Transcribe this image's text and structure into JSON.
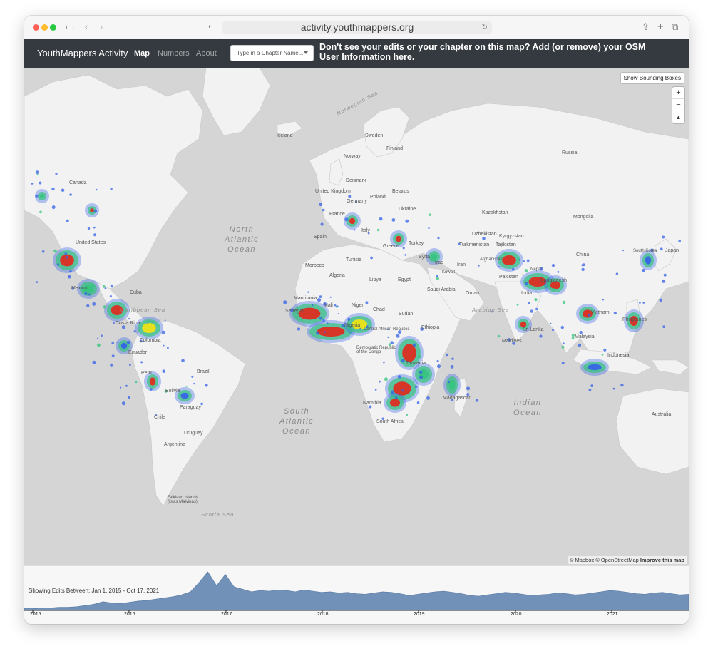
{
  "browser": {
    "url": "activity.youthmappers.org"
  },
  "navbar": {
    "brand": "YouthMappers Activity",
    "links": [
      "Map",
      "Numbers",
      "About"
    ],
    "chapter_placeholder": "Type in a Chapter Name...",
    "banner": "Don't see your edits or your chapter on this map? Add (or remove) your OSM User Information here."
  },
  "map": {
    "bounding_boxes_button": "Show Bounding Boxes",
    "zoom_in": "+",
    "zoom_out": "−",
    "compass": "▲",
    "attribution": "© Mapbox © OpenStreetMap",
    "improve": "Improve this map",
    "oceans": {
      "north_atlantic": "North Atlantic Ocean",
      "south_atlantic": "South Atlantic Ocean",
      "indian": "Indian Ocean",
      "norwegian_sea": "Norwegian Sea",
      "arabian_sea": "Arabian Sea",
      "caribbean_sea": "Caribbean Sea",
      "scotia_sea": "Scotia Sea"
    },
    "places": {
      "canada": "Canada",
      "united_states": "United States",
      "mexico": "Mexico",
      "cuba": "Cuba",
      "costa_rica": "Costa Rica",
      "colombia": "Colombia",
      "ecuador": "Ecuador",
      "peru": "Peru",
      "brazil": "Brazil",
      "bolivia": "Bolivia",
      "paraguay": "Paraguay",
      "chile": "Chile",
      "argentina": "Argentina",
      "uruguay": "Uruguay",
      "falkland": "Falkland Islands (Islas Malvinas)",
      "iceland": "Iceland",
      "sweden": "Sweden",
      "finland": "Finland",
      "norway": "Norway",
      "denmark": "Denmark",
      "united_kingdom": "United Kingdom",
      "poland": "Poland",
      "belarus": "Belarus",
      "germany": "Germany",
      "ukraine": "Ukraine",
      "france": "France",
      "italy": "Italy",
      "spain": "Spain",
      "greece": "Greece",
      "turkey": "Turkey",
      "russia": "Russia",
      "kazakhstan": "Kazakhstan",
      "mongolia": "Mongolia",
      "uzbekistan": "Uzbekistan",
      "kyrgyzstan": "Kyrgyzstan",
      "turkmenistan": "Turkmenistan",
      "tajikistan": "Tajikistan",
      "china": "China",
      "south_korea": "South Korea",
      "japan": "Japan",
      "syria": "Syria",
      "iraq": "Iraq",
      "iran": "Iran",
      "afghanistan": "Afghanistan",
      "pakistan": "Pakistan",
      "india": "India",
      "nepal": "Nepal",
      "bangladesh": "Bangladesh",
      "sri_lanka": "Sri Lanka",
      "maldives": "Maldives",
      "vietnam": "Vietnam",
      "philippines": "Philippines",
      "malaysia": "Malaysia",
      "indonesia": "Indonesia",
      "australia": "Australia",
      "morocco": "Morocco",
      "algeria": "Algeria",
      "tunisia": "Tunisia",
      "libya": "Libya",
      "egypt": "Egypt",
      "saudi_arabia": "Saudi Arabia",
      "oman": "Oman",
      "mauritania": "Mauritania",
      "mali": "Mali",
      "niger": "Niger",
      "chad": "Chad",
      "sudan": "Sudan",
      "ethiopia": "Ethiopia",
      "senegal": "Senegal",
      "nigeria": "Nigeria",
      "car": "Central African Republic",
      "drc": "Democratic Republic of the Congo",
      "tanzania": "Tanzania",
      "namibia": "Namibia",
      "madagascar": "Madagascar",
      "south_africa": "South Africa",
      "kuwait": "Kuwait"
    }
  },
  "timeline": {
    "caption": "Showing Edits Between: Jan 1, 2015 - Oct 17, 2021",
    "years": [
      "2015",
      "2016",
      "2017",
      "2018",
      "2019",
      "2020",
      "2021"
    ],
    "series": [
      3,
      3,
      4,
      4,
      5,
      5,
      6,
      8,
      10,
      14,
      12,
      11,
      13,
      15,
      16,
      18,
      20,
      22,
      25,
      30,
      45,
      62,
      40,
      58,
      38,
      34,
      30,
      32,
      31,
      33,
      32,
      30,
      33,
      31,
      29,
      30,
      28,
      29,
      27,
      26,
      28,
      30,
      29,
      27,
      24,
      26,
      28,
      30,
      31,
      29,
      27,
      24,
      23,
      25,
      27,
      29,
      28,
      26,
      24,
      25,
      26,
      28,
      27,
      25,
      26,
      28,
      30,
      32,
      31,
      29,
      27,
      26,
      28,
      29,
      27,
      25,
      26
    ],
    "color": "#7291b8"
  },
  "colors": {
    "land": "#f2f2f2",
    "water": "#d5d5d5",
    "navbar": "#343a40",
    "heat_red": "#e3271b",
    "heat_yellow": "#f4e50e",
    "heat_green": "#34c47c",
    "heat_blue": "#3462e8"
  }
}
